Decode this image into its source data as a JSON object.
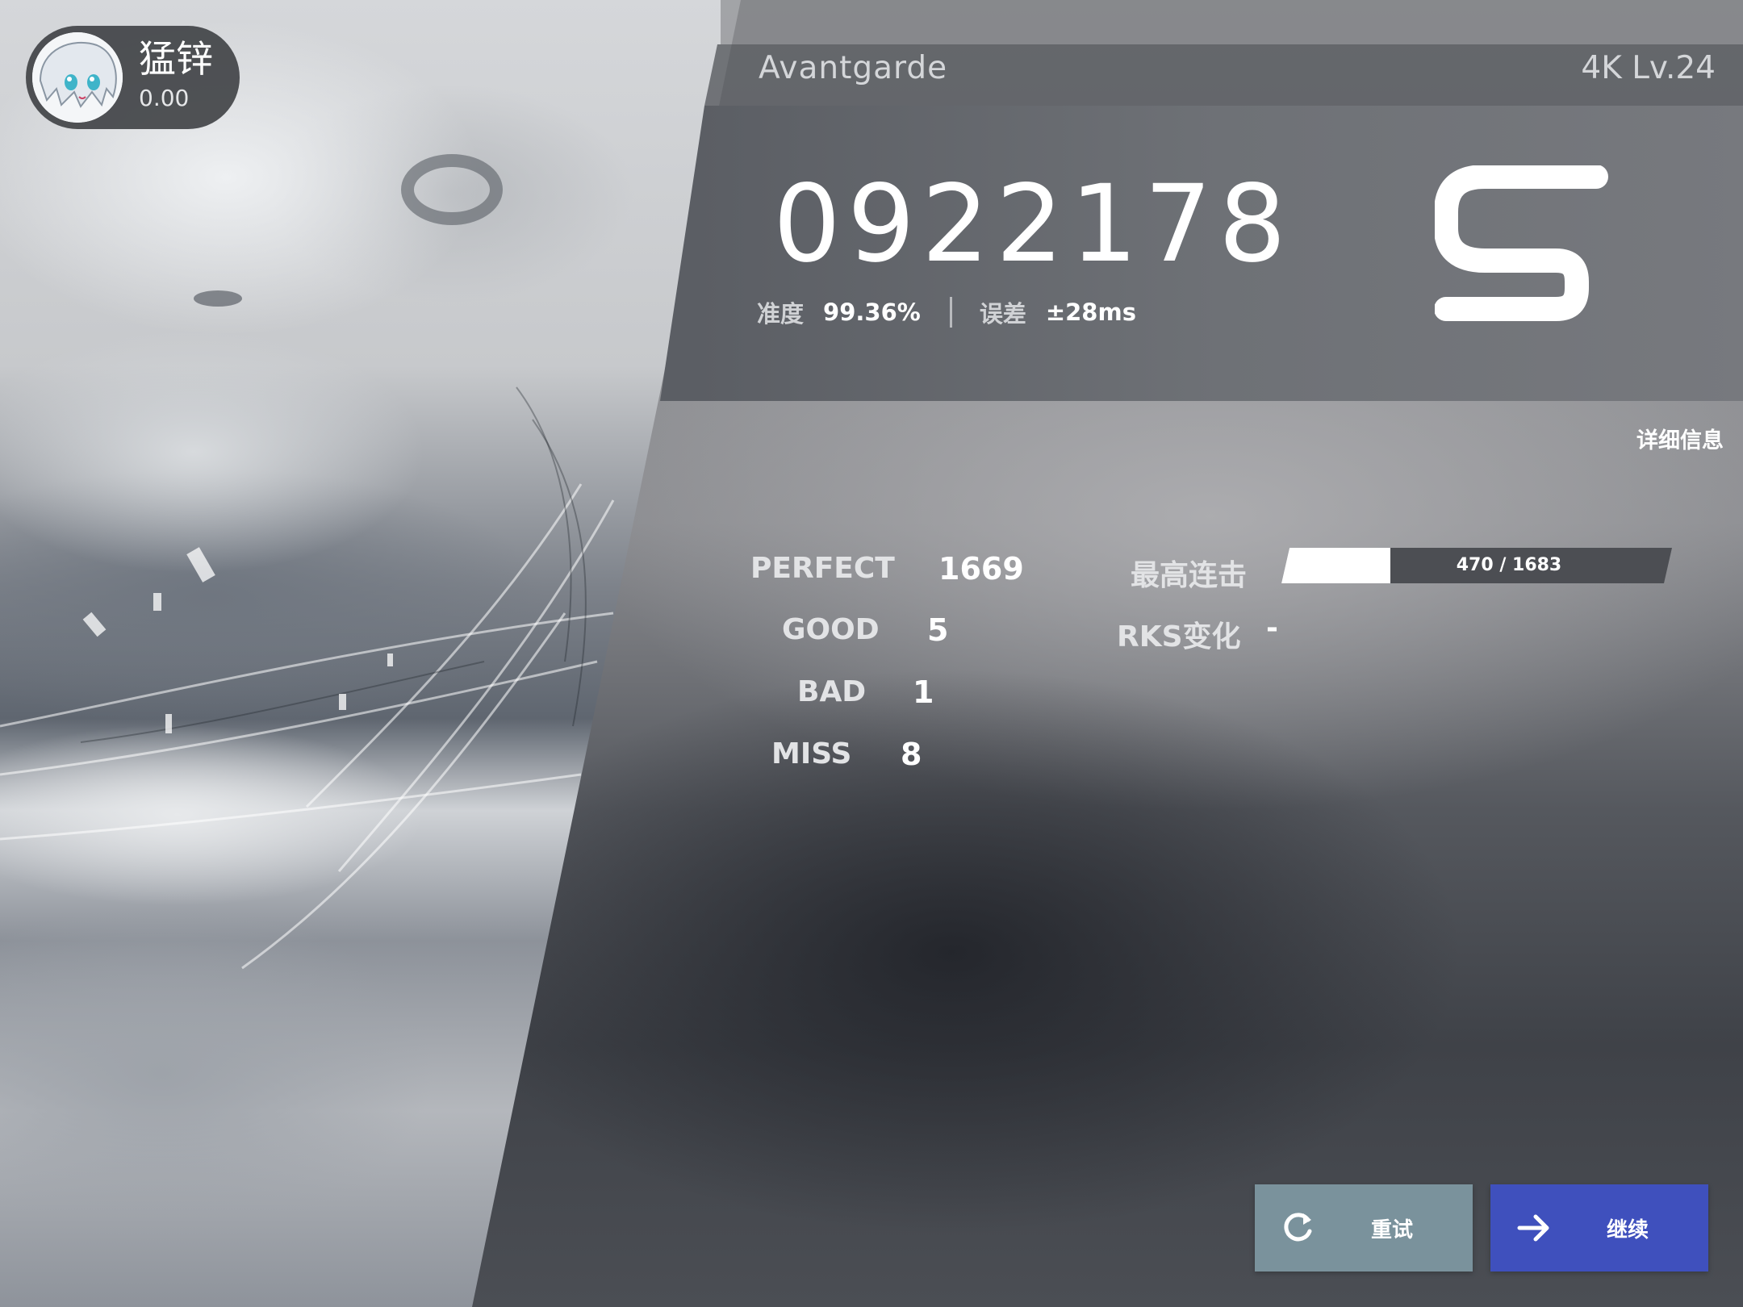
{
  "player": {
    "name": "猛锌",
    "rks": "0.00",
    "avatar_icon": "avatar-icon"
  },
  "song": {
    "title": "Avantgarde",
    "level": "4K Lv.24"
  },
  "result": {
    "score": "0922178",
    "accuracy_label": "准度",
    "accuracy": "99.36%",
    "error_label": "误差",
    "error": "±28ms",
    "grade": "S"
  },
  "details_link": "详细信息",
  "judgements": [
    {
      "label": "PERFECT",
      "value": "1669"
    },
    {
      "label": "GOOD",
      "value": "5"
    },
    {
      "label": "BAD",
      "value": "1"
    },
    {
      "label": "MISS",
      "value": "8"
    }
  ],
  "max_combo": {
    "label": "最高连击",
    "text": "470 / 1683",
    "current": 470,
    "total": 1683
  },
  "rks_change": {
    "label": "RKS变化",
    "value": "-"
  },
  "buttons": {
    "retry": {
      "label": "重试",
      "icon": "refresh-icon",
      "color": "#7a929c"
    },
    "continue": {
      "label": "继续",
      "icon": "arrow-right-icon",
      "color": "#3f50bd"
    }
  }
}
